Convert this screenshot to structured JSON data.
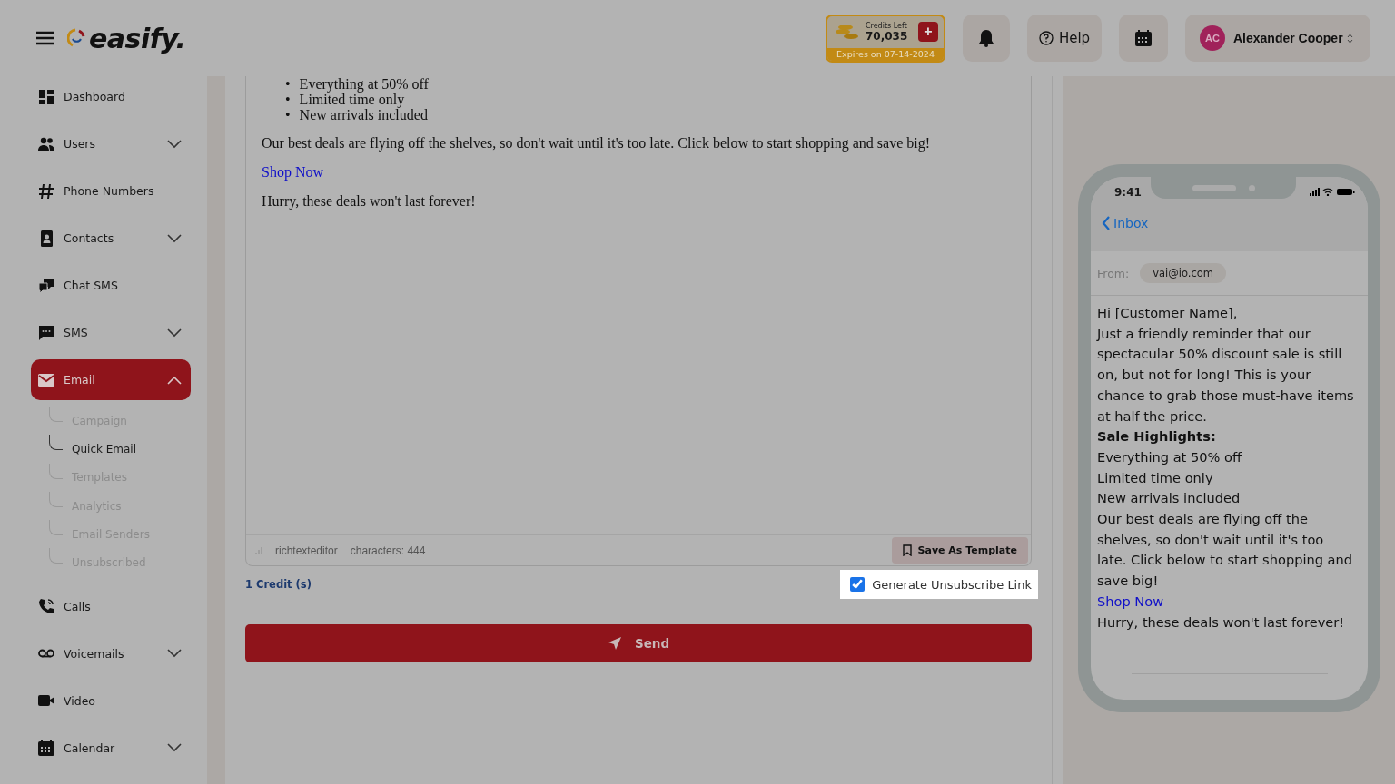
{
  "header": {
    "logo": "easify.",
    "credits": {
      "label": "Credits Left",
      "amount": "70,035",
      "add": "+",
      "expiry": "Expires on 07-14-2024"
    },
    "help": "Help",
    "user": {
      "initials": "AC",
      "name": "Alexander Cooper"
    }
  },
  "sidebar": {
    "items": [
      {
        "label": "Dashboard",
        "kind": "link",
        "selected": false
      },
      {
        "label": "Users",
        "kind": "group",
        "expanded": false,
        "selected": false
      },
      {
        "label": "Phone Numbers",
        "kind": "link",
        "selected": false
      },
      {
        "label": "Contacts",
        "kind": "group",
        "expanded": false,
        "selected": false
      },
      {
        "label": "Chat SMS",
        "kind": "link",
        "selected": false
      },
      {
        "label": "SMS",
        "kind": "group",
        "expanded": false,
        "selected": false
      },
      {
        "label": "Email",
        "kind": "group",
        "expanded": true,
        "selected": true,
        "children": [
          {
            "label": "Campaign",
            "selected": false
          },
          {
            "label": "Quick Email",
            "selected": true
          },
          {
            "label": "Templates",
            "selected": false
          },
          {
            "label": "Analytics",
            "selected": false
          },
          {
            "label": "Email Senders",
            "selected": false
          },
          {
            "label": "Unsubscribed",
            "selected": false
          }
        ]
      },
      {
        "label": "Calls",
        "kind": "link",
        "selected": false
      },
      {
        "label": "Voicemails",
        "kind": "group",
        "expanded": false,
        "selected": false
      },
      {
        "label": "Video",
        "kind": "link",
        "selected": false
      },
      {
        "label": "Calendar",
        "kind": "group",
        "expanded": false,
        "selected": false
      }
    ]
  },
  "editor": {
    "bullet_marker": "•",
    "bullets": [
      "Everything at 50% off",
      "Limited time only",
      "New arrivals included"
    ],
    "paragraph": "Our best deals are flying off the shelves, so don't wait until it's too late. Click below to start shopping and save big!",
    "link": "Shop Now",
    "closing": "Hurry, these deals won't last forever!",
    "footer": {
      "resize_label": "richtexteditor",
      "characters": "characters: 444",
      "save_button": "Save As Template"
    }
  },
  "credit_cost": "1 Credit (s)",
  "unsubscribe": {
    "label": "Generate Unsubscribe Link",
    "checked": true
  },
  "send_button": "Send",
  "preview": {
    "time": "9:41",
    "back": "Inbox",
    "from_label": "From:",
    "from": "vai@io.com",
    "body": [
      {
        "kind": "text",
        "text": "Hi [Customer Name],"
      },
      {
        "kind": "text",
        "text": "Just a friendly reminder that our spectacular 50% discount sale is still on, but not for long! This is your chance to grab those must-have items at half the price."
      },
      {
        "kind": "heading",
        "text": "Sale Highlights:"
      },
      {
        "kind": "text",
        "text": "Everything at 50% off"
      },
      {
        "kind": "text",
        "text": "Limited time only"
      },
      {
        "kind": "text",
        "text": "New arrivals included"
      },
      {
        "kind": "text",
        "text": "Our best deals are flying off the shelves, so don't wait until it's too late. Click below to start shopping and save big!"
      },
      {
        "kind": "link",
        "text": "Shop Now"
      },
      {
        "kind": "text",
        "text": "Hurry, these deals won't last forever!"
      }
    ]
  }
}
